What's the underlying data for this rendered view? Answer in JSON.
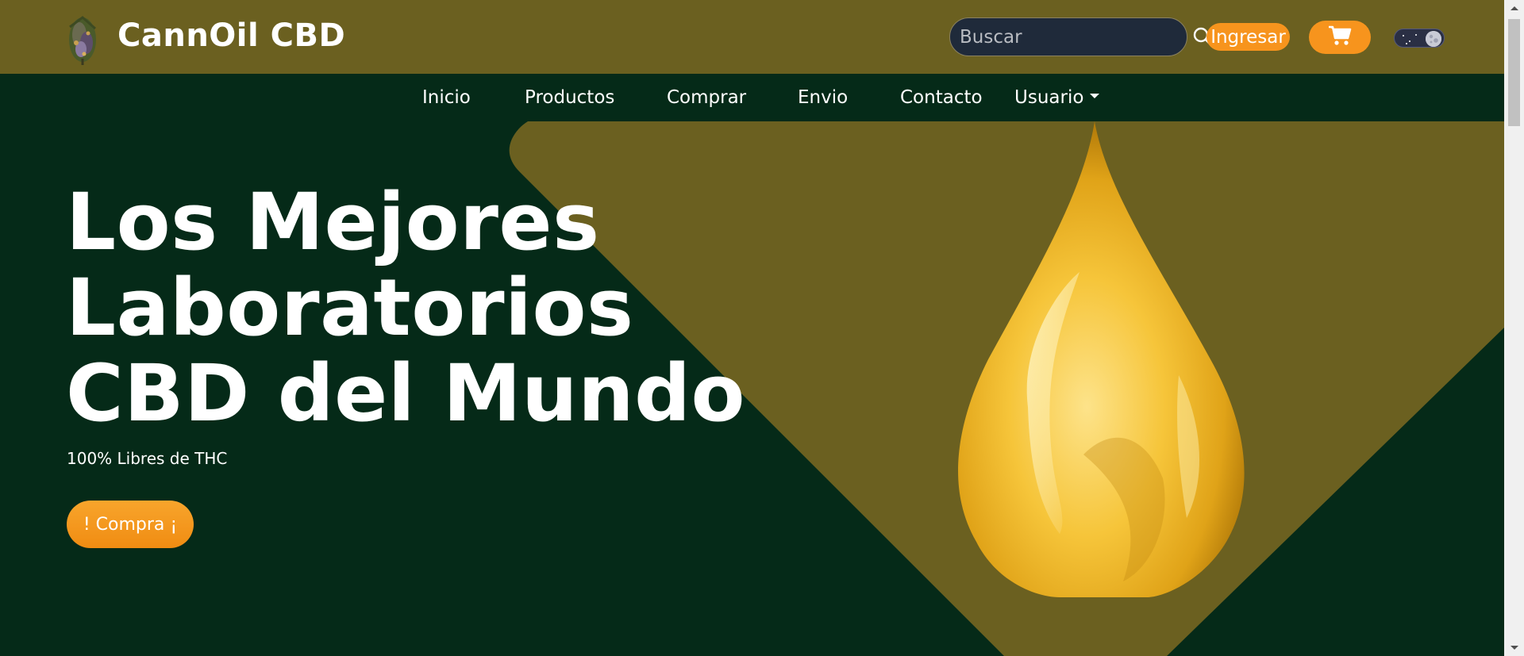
{
  "brand": {
    "name": "CannOil CBD",
    "logo_icon": "cannabis-bud-icon"
  },
  "search": {
    "placeholder": "Buscar",
    "icon": "search-icon"
  },
  "header": {
    "login_label": "Ingresar",
    "cart_icon": "cart-icon",
    "theme_toggle": "dark-mode-toggle"
  },
  "nav": {
    "items": [
      {
        "label": "Inicio"
      },
      {
        "label": "Productos"
      },
      {
        "label": "Comprar"
      },
      {
        "label": "Envio"
      },
      {
        "label": "Contacto"
      },
      {
        "label": "Usuario"
      }
    ]
  },
  "hero": {
    "headline_line1": "Los Mejores",
    "headline_line2": "Laboratorios",
    "headline_line3": "CBD del Mundo",
    "subline": "100% Libres de THC",
    "cta_label": "! Compra ¡",
    "image_icon": "oil-drop-icon"
  },
  "colors": {
    "olive": "#6b6020",
    "dark_green": "#052a18",
    "accent_orange": "#f7941d",
    "oil_gold": "#f2b824"
  }
}
